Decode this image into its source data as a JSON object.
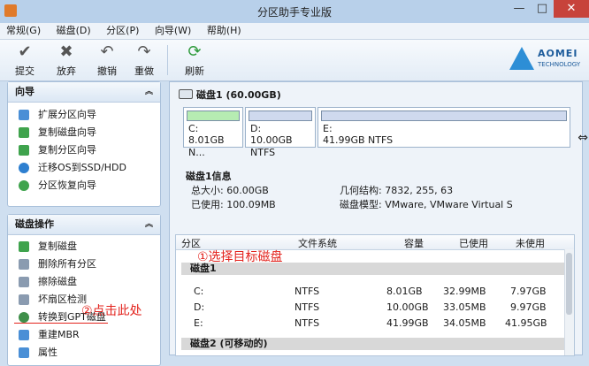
{
  "window": {
    "title": "分区助手专业版",
    "minimize": "—",
    "maximize": "□",
    "close": "✕"
  },
  "menu": [
    "常规(G)",
    "磁盘(D)",
    "分区(P)",
    "向导(W)",
    "帮助(H)"
  ],
  "toolbar": {
    "commit": "提交",
    "discard": "放弃",
    "undo": "撤销",
    "redo": "重做",
    "refresh": "刷新",
    "logo_main": "AOMEI",
    "logo_sub": "TECHNOLOGY",
    "icons": [
      "check-icon",
      "x-icon",
      "undo-icon",
      "redo-icon",
      "refresh-icon"
    ]
  },
  "wizard": {
    "title": "向导",
    "items": [
      "扩展分区向导",
      "复制磁盘向导",
      "复制分区向导",
      "迁移OS到SSD/HDD",
      "分区恢复向导"
    ]
  },
  "disk_ops": {
    "title": "磁盘操作",
    "items": [
      "复制磁盘",
      "删除所有分区",
      "擦除磁盘",
      "坏扇区检测",
      "转换到GPT磁盘",
      "重建MBR",
      "属性"
    ]
  },
  "disk_map": {
    "header": "磁盘1 (60.00GB)",
    "partitions": [
      {
        "label": "C:",
        "detail": "8.01GB N...",
        "bar_color": "#b6ecb2"
      },
      {
        "label": "D:",
        "detail": "10.00GB NTFS",
        "bar_color": "#cfd9ee"
      },
      {
        "label": "E:",
        "detail": "41.99GB NTFS",
        "bar_color": "#cfd9ee"
      }
    ]
  },
  "disk_info": {
    "title": "磁盘1信息",
    "total_label": "总大小: 60.00GB",
    "used_label": "已使用: 100.09MB",
    "geometry_label": "几何结构: 7832, 255, 63",
    "model_label": "磁盘模型: VMware, VMware Virtual S"
  },
  "table": {
    "columns": [
      "分区",
      "文件系统",
      "容量",
      "已使用",
      "未使用"
    ],
    "group1": "磁盘1",
    "rows": [
      [
        "C:",
        "NTFS",
        "8.01GB",
        "32.99MB",
        "7.97GB"
      ],
      [
        "D:",
        "NTFS",
        "10.00GB",
        "33.05MB",
        "9.97GB"
      ],
      [
        "E:",
        "NTFS",
        "41.99GB",
        "34.05MB",
        "41.95GB"
      ]
    ],
    "group2": "磁盘2 (可移动的)"
  },
  "annotations": {
    "step1": "①选择目标磁盘",
    "step2": "②点击此处"
  }
}
